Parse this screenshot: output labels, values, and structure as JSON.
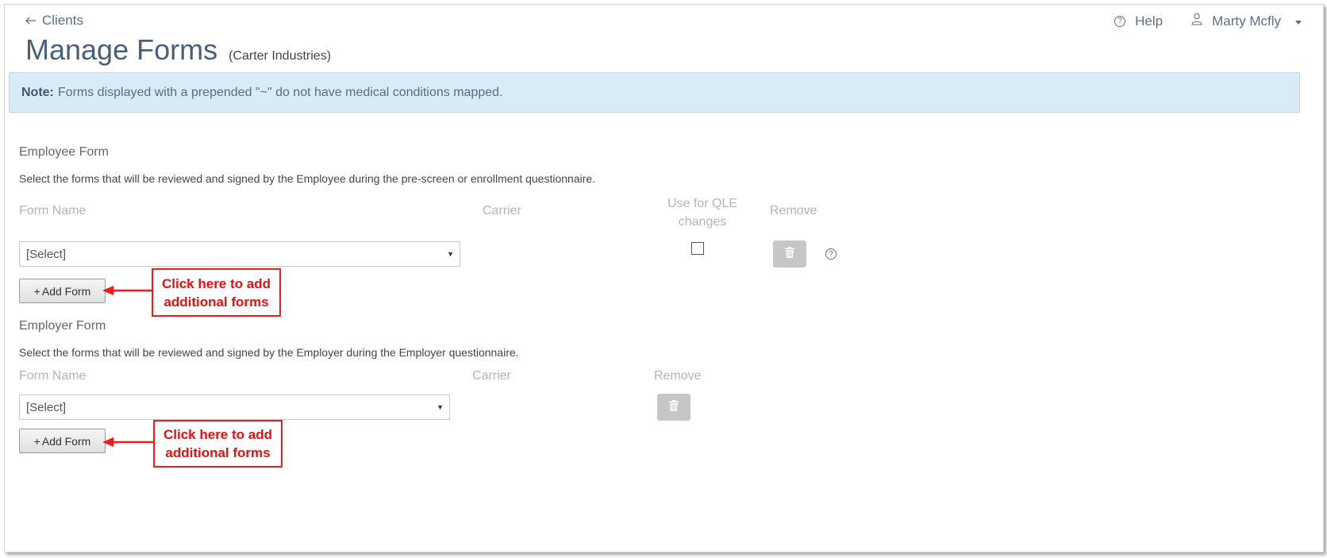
{
  "header": {
    "back_label": "Clients",
    "title": "Manage Forms",
    "subtitle": "(Carter Industries)",
    "help_label": "Help",
    "user_name": "Marty Mcfly"
  },
  "note": {
    "label": "Note:",
    "text": "Forms displayed with a prepended \"~\" do not have medical conditions mapped."
  },
  "employee_section": {
    "title": "Employee Form",
    "description": "Select the forms that will be reviewed and signed by the Employee during the pre-screen or enrollment questionnaire.",
    "columns": {
      "form_name": "Form Name",
      "carrier": "Carrier",
      "qle": "Use for QLE changes",
      "remove": "Remove"
    },
    "select_value": "[Select]",
    "qle_checked": false,
    "add_button": "Add Form"
  },
  "employer_section": {
    "title": "Employer Form",
    "description": "Select the forms that will be reviewed and signed by the Employer during the Employer questionnaire.",
    "columns": {
      "form_name": "Form Name",
      "carrier": "Carrier",
      "remove": "Remove"
    },
    "select_value": "[Select]",
    "add_button": "Add Form"
  },
  "annotations": {
    "callout_1": "Click here to add\nadditional forms",
    "callout_2": "Click here to add\nadditional forms",
    "color": "#ee1c1c"
  },
  "colors": {
    "title": "#4a5f78",
    "note_bg": "#d9ebf6",
    "column_header": "#b4b4b4",
    "disabled_button": "#c6c6c6"
  }
}
